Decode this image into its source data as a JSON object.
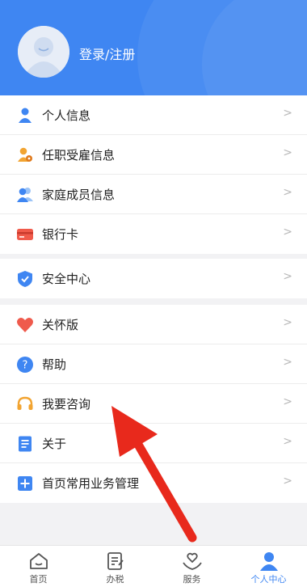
{
  "profile": {
    "login_label": "登录/注册"
  },
  "menu": {
    "group1": [
      {
        "label": "个人信息",
        "icon": "person-icon"
      },
      {
        "label": "任职受雇信息",
        "icon": "employment-icon"
      },
      {
        "label": "家庭成员信息",
        "icon": "family-icon"
      },
      {
        "label": "银行卡",
        "icon": "bank-card-icon"
      }
    ],
    "group2": [
      {
        "label": "安全中心",
        "icon": "shield-icon"
      }
    ],
    "group3": [
      {
        "label": "关怀版",
        "icon": "heart-icon"
      },
      {
        "label": "帮助",
        "icon": "question-icon"
      },
      {
        "label": "我要咨询",
        "icon": "headset-icon"
      },
      {
        "label": "关于",
        "icon": "document-icon"
      },
      {
        "label": "首页常用业务管理",
        "icon": "plus-square-icon"
      }
    ]
  },
  "tabbar": {
    "tabs": [
      {
        "label": "首页",
        "icon": "home-icon"
      },
      {
        "label": "办税",
        "icon": "tax-form-icon"
      },
      {
        "label": "服务",
        "icon": "service-hands-icon"
      },
      {
        "label": "个人中心",
        "icon": "user-center-icon",
        "active": true
      }
    ]
  },
  "colors": {
    "brand": "#3f86f2",
    "arrow": "#e8291c"
  }
}
